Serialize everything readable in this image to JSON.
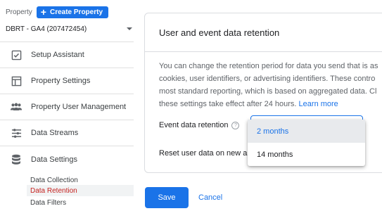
{
  "sidebar": {
    "property_label": "Property",
    "create_button": "Create Property",
    "selected_property": "DBRT - GA4 (207472454)",
    "items": [
      {
        "label": "Setup Assistant",
        "icon": "checklist-icon"
      },
      {
        "label": "Property Settings",
        "icon": "layout-icon"
      },
      {
        "label": "Property User Management",
        "icon": "people-icon"
      },
      {
        "label": "Data Streams",
        "icon": "streams-icon"
      },
      {
        "label": "Data Settings",
        "icon": "database-icon"
      }
    ],
    "subitems": [
      {
        "label": "Data Collection"
      },
      {
        "label": "Data Retention"
      },
      {
        "label": "Data Filters"
      }
    ],
    "active_subitem": "Data Retention"
  },
  "card": {
    "title": "User and event data retention",
    "description_lines": [
      "You can change the retention period for data you send that is as",
      "cookies, user identifiers, or advertising identifiers. These contro",
      "most standard reporting, which is based on aggregated data. Cl"
    ],
    "description_last": "these settings take effect after 24 hours.",
    "learn_more": "Learn more",
    "event_retention_label": "Event data retention",
    "reset_label": "Reset user data on new a"
  },
  "dropdown": {
    "options": [
      "2 months",
      "14 months"
    ],
    "selected": "2 months"
  },
  "actions": {
    "save": "Save",
    "cancel": "Cancel"
  },
  "colors": {
    "accent": "#1a73e8",
    "active_text": "#c5221f"
  }
}
